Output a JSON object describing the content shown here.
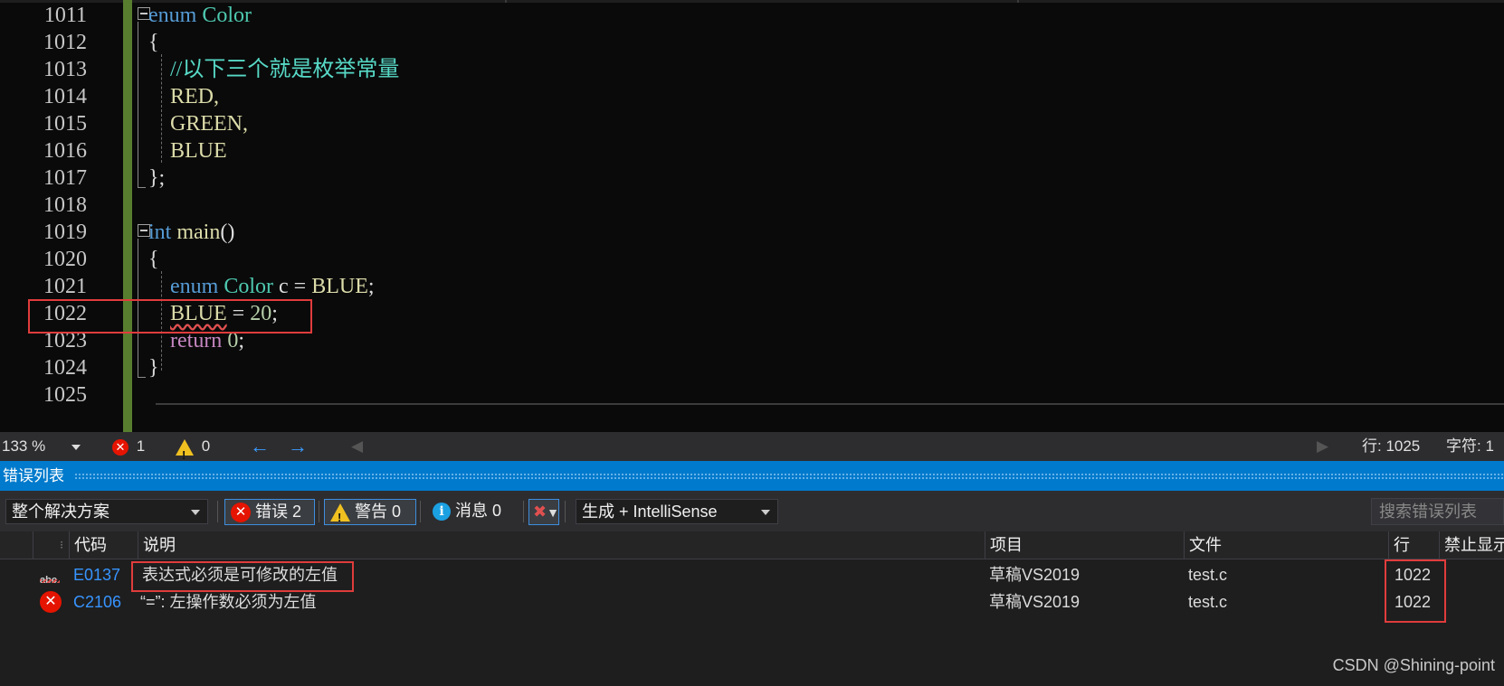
{
  "editor": {
    "lines": [
      {
        "num": "1011",
        "tokens": [
          {
            "t": "enum",
            "c": "kw"
          },
          {
            "t": " ",
            "c": ""
          },
          {
            "t": "Color",
            "c": "ty"
          }
        ]
      },
      {
        "num": "1012",
        "tokens": [
          {
            "t": "{",
            "c": ""
          }
        ]
      },
      {
        "num": "1013",
        "tokens": [
          {
            "t": "    //以下三个就是枚举常量",
            "c": "cm"
          }
        ]
      },
      {
        "num": "1014",
        "tokens": [
          {
            "t": "    RED,",
            "c": "id"
          }
        ]
      },
      {
        "num": "1015",
        "tokens": [
          {
            "t": "    GREEN,",
            "c": "id"
          }
        ]
      },
      {
        "num": "1016",
        "tokens": [
          {
            "t": "    BLUE",
            "c": "id"
          }
        ]
      },
      {
        "num": "1017",
        "tokens": [
          {
            "t": "};",
            "c": ""
          }
        ]
      },
      {
        "num": "1018",
        "tokens": []
      },
      {
        "num": "1019",
        "tokens": [
          {
            "t": "int",
            "c": "kw"
          },
          {
            "t": " ",
            "c": ""
          },
          {
            "t": "main",
            "c": "id"
          },
          {
            "t": "()",
            "c": ""
          }
        ]
      },
      {
        "num": "1020",
        "tokens": [
          {
            "t": "{",
            "c": ""
          }
        ]
      },
      {
        "num": "1021",
        "tokens": [
          {
            "t": "    ",
            "c": ""
          },
          {
            "t": "enum",
            "c": "kw"
          },
          {
            "t": " ",
            "c": ""
          },
          {
            "t": "Color",
            "c": "ty"
          },
          {
            "t": " c = ",
            "c": ""
          },
          {
            "t": "BLUE",
            "c": "id"
          },
          {
            "t": ";",
            "c": ""
          }
        ]
      },
      {
        "num": "1022",
        "tokens": [
          {
            "t": "    ",
            "c": ""
          },
          {
            "t": "BLUE",
            "c": "id squig"
          },
          {
            "t": " = ",
            "c": ""
          },
          {
            "t": "20",
            "c": "num"
          },
          {
            "t": ";",
            "c": ""
          }
        ]
      },
      {
        "num": "1023",
        "tokens": [
          {
            "t": "    ",
            "c": ""
          },
          {
            "t": "return",
            "c": "ret"
          },
          {
            "t": " ",
            "c": ""
          },
          {
            "t": "0",
            "c": "num"
          },
          {
            "t": ";",
            "c": ""
          }
        ]
      },
      {
        "num": "1024",
        "tokens": [
          {
            "t": "}",
            "c": ""
          }
        ]
      },
      {
        "num": "1025",
        "tokens": []
      }
    ]
  },
  "statusbar": {
    "zoom": "133 %",
    "errors": "1",
    "warnings": "0",
    "line_label": "行: 1025",
    "col_label": "字符: 1"
  },
  "errorlist": {
    "title": "错误列表",
    "scope": "整个解决方案",
    "errors_btn": "错误 2",
    "warnings_btn": "警告 0",
    "messages_btn": "消息 0",
    "build_filter": "生成 + IntelliSense",
    "search_placeholder": "搜索错误列表",
    "columns": {
      "code": "代码",
      "description": "说明",
      "project": "项目",
      "file": "文件",
      "line": "行",
      "suppress": "禁止显示"
    },
    "rows": [
      {
        "code": "E0137",
        "description": "表达式必须是可修改的左值",
        "project": "草稿VS2019",
        "file": "test.c",
        "line": "1022",
        "icon": "intellisense-squiggle-icon"
      },
      {
        "code": "C2106",
        "description": "“=”: 左操作数必须为左值",
        "project": "草稿VS2019",
        "file": "test.c",
        "line": "1022",
        "icon": "error-icon"
      }
    ]
  },
  "watermark": "CSDN @Shining-point",
  "colors": {
    "accent": "#007acc",
    "error": "#e51400",
    "highlight_box": "#e03c3c",
    "gutter_change": "#577e2f"
  }
}
